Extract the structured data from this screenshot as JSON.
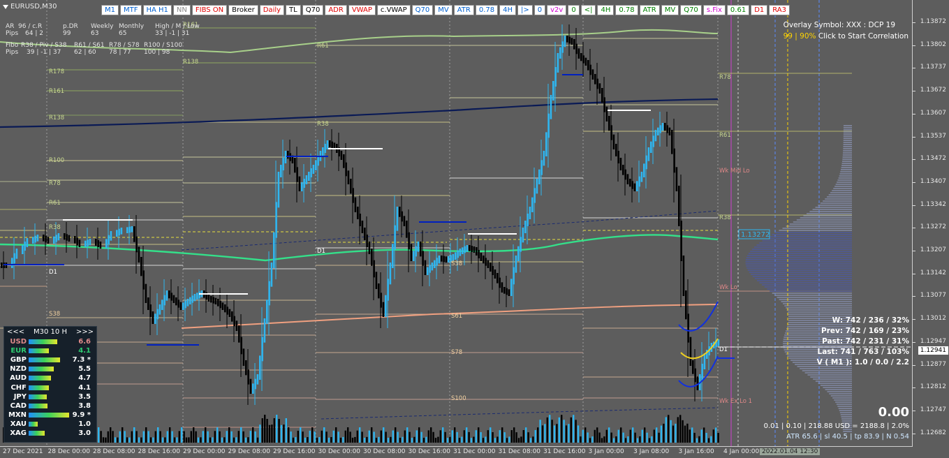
{
  "window": {
    "symbol_title": "EURUSD,M30"
  },
  "toolbar": [
    {
      "label": "M1",
      "color": "#0060d0"
    },
    {
      "label": "MTF",
      "color": "#0060d0"
    },
    {
      "label": "HA H1",
      "color": "#0060d0"
    },
    {
      "label": "NN",
      "color": "#888888"
    },
    {
      "label": "FIBS ON",
      "color": "#e00000"
    },
    {
      "label": "Broker",
      "color": "#000000"
    },
    {
      "label": "Daily",
      "color": "#e00000"
    },
    {
      "label": "TL",
      "color": "#000000"
    },
    {
      "label": "Q70",
      "color": "#000000"
    },
    {
      "label": "ADR",
      "color": "#e00000"
    },
    {
      "label": "VWAP",
      "color": "#e00000"
    },
    {
      "label": "c.VWAP",
      "color": "#000000"
    },
    {
      "label": "Q70",
      "color": "#0060d0"
    },
    {
      "label": "MV",
      "color": "#0060d0"
    },
    {
      "label": "ATR",
      "color": "#0060d0"
    },
    {
      "label": "0.78",
      "color": "#0060d0"
    },
    {
      "label": "4H",
      "color": "#0060d0"
    },
    {
      "label": "|>",
      "color": "#0060d0"
    },
    {
      "label": "0",
      "color": "#0060d0"
    },
    {
      "label": "v2v",
      "color": "#d000d0"
    },
    {
      "label": "0",
      "color": "#008000"
    },
    {
      "label": "<|",
      "color": "#008000"
    },
    {
      "label": "4H",
      "color": "#008000"
    },
    {
      "label": "0.78",
      "color": "#008000"
    },
    {
      "label": "ATR",
      "color": "#008000"
    },
    {
      "label": "MV",
      "color": "#008000"
    },
    {
      "label": "Q70",
      "color": "#008000"
    },
    {
      "label": "s.Fix",
      "color": "#d000d0"
    },
    {
      "label": "0.61",
      "color": "#008000"
    },
    {
      "label": "D1",
      "color": "#e00000"
    },
    {
      "label": "RA3",
      "color": "#e00000"
    }
  ],
  "range_panel": {
    "header": [
      "AR",
      "96 / c.R",
      "p.DR",
      "Weekly",
      "Monthly",
      "High / M / Low"
    ],
    "pips": [
      "Pips",
      "64 | 2",
      "99",
      "63",
      "65",
      "33 | -1 | 31"
    ],
    "fibo_header": [
      "Fibo",
      "R38 / Piv / S38",
      "R61 / S61",
      "R78 / S78",
      "R100 / S100"
    ],
    "fibo_pips": [
      "Pips",
      "39 | -1 | 37",
      "62 | 60",
      "78 | 77",
      "100 | 98"
    ]
  },
  "overlay": {
    "line1": "Overlay Symbol: XXX : DCP 19",
    "line2_highlight": "99 | 90%",
    "line2_rest": " Click to Start Correlation"
  },
  "price_axis": [
    "1.13872",
    "1.13802",
    "1.13737",
    "1.13672",
    "1.13607",
    "1.13537",
    "1.13472",
    "1.13407",
    "1.13342",
    "1.13272",
    "1.13207",
    "1.13142",
    "1.13077",
    "1.13012",
    "1.12947",
    "1.12877",
    "1.12812",
    "1.12747",
    "1.12682"
  ],
  "current_price": "1.12941",
  "marker_price": "1.13272",
  "time_axis": [
    "27 Dec 2021",
    "28 Dec 00:00",
    "28 Dec 08:00",
    "28 Dec 16:00",
    "29 Dec 00:00",
    "29 Dec 08:00",
    "29 Dec 16:00",
    "30 Dec 00:00",
    "30 Dec 08:00",
    "30 Dec 16:00",
    "31 Dec 00:00",
    "31 Dec 08:00",
    "31 Dec 16:00",
    "3 Jan 00:00",
    "3 Jan 08:00",
    "3 Jan 16:00",
    "4 Jan 00:00"
  ],
  "time_cursor": "2022.01.04 12:30",
  "stats": {
    "w": "W: 742 / 236 / 32%",
    "prev": "Prev: 742 / 169 / 23%",
    "past": "Past: 742 / 231 / 31%",
    "last": "Last: 741 / 763 / 103%",
    "v": "V ( M1 ): 1.0 / 0.0 / 2.2"
  },
  "big_value": "0.00",
  "costs": {
    "line1": "0.01  |  0.10  |  218.88 USD = 2188.8  |  2.0%",
    "line2": "ATR 65.6  |  sl 40.5  |  tp 83.9  |  N 0.54"
  },
  "strength_panel": {
    "prev": "<<<",
    "tf": "M30  10  H",
    "next": ">>>",
    "currencies": [
      {
        "name": "USD",
        "value": "6.6",
        "color": "#e08a8a",
        "strength": 0.66
      },
      {
        "name": "EUR",
        "value": "4.1",
        "color": "#2ecc71",
        "strength": 0.41
      },
      {
        "name": "GBP",
        "value": "7.3 *",
        "color": "#ffffff",
        "strength": 0.73
      },
      {
        "name": "NZD",
        "value": "5.5",
        "color": "#ffffff",
        "strength": 0.55
      },
      {
        "name": "AUD",
        "value": "4.7",
        "color": "#ffffff",
        "strength": 0.47
      },
      {
        "name": "CHF",
        "value": "4.1",
        "color": "#ffffff",
        "strength": 0.41
      },
      {
        "name": "JPY",
        "value": "3.5",
        "color": "#ffffff",
        "strength": 0.35
      },
      {
        "name": "CAD",
        "value": "3.8",
        "color": "#ffffff",
        "strength": 0.38
      },
      {
        "name": "MXN",
        "value": "9.9 *",
        "color": "#ffffff",
        "strength": 0.99
      },
      {
        "name": "XAU",
        "value": "1.0",
        "color": "#ffffff",
        "strength": 0.1
      },
      {
        "name": "XAG",
        "value": "3.0",
        "color": "#ffffff",
        "strength": 0.3
      }
    ]
  },
  "level_labels": [
    "R161",
    "R138",
    "R178",
    "R161",
    "R138",
    "R100",
    "R78",
    "R61",
    "R38",
    "D1",
    "S38",
    "S61",
    "S78",
    "S100",
    "S138",
    "R61",
    "R38",
    "D1",
    "S38",
    "S61",
    "S78",
    "S100",
    "R78",
    "R61",
    "R38",
    "D1",
    "Wk Mid Lo",
    "Wk Lo",
    "Wk Ex Lo 1"
  ]
}
